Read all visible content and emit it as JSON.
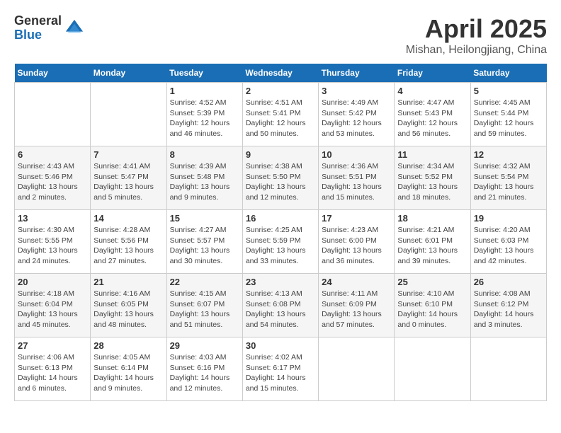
{
  "logo": {
    "general": "General",
    "blue": "Blue"
  },
  "title": "April 2025",
  "subtitle": "Mishan, Heilongjiang, China",
  "days_of_week": [
    "Sunday",
    "Monday",
    "Tuesday",
    "Wednesday",
    "Thursday",
    "Friday",
    "Saturday"
  ],
  "weeks": [
    [
      {
        "day": "",
        "info": ""
      },
      {
        "day": "",
        "info": ""
      },
      {
        "day": "1",
        "info": "Sunrise: 4:52 AM\nSunset: 5:39 PM\nDaylight: 12 hours and 46 minutes."
      },
      {
        "day": "2",
        "info": "Sunrise: 4:51 AM\nSunset: 5:41 PM\nDaylight: 12 hours and 50 minutes."
      },
      {
        "day": "3",
        "info": "Sunrise: 4:49 AM\nSunset: 5:42 PM\nDaylight: 12 hours and 53 minutes."
      },
      {
        "day": "4",
        "info": "Sunrise: 4:47 AM\nSunset: 5:43 PM\nDaylight: 12 hours and 56 minutes."
      },
      {
        "day": "5",
        "info": "Sunrise: 4:45 AM\nSunset: 5:44 PM\nDaylight: 12 hours and 59 minutes."
      }
    ],
    [
      {
        "day": "6",
        "info": "Sunrise: 4:43 AM\nSunset: 5:46 PM\nDaylight: 13 hours and 2 minutes."
      },
      {
        "day": "7",
        "info": "Sunrise: 4:41 AM\nSunset: 5:47 PM\nDaylight: 13 hours and 5 minutes."
      },
      {
        "day": "8",
        "info": "Sunrise: 4:39 AM\nSunset: 5:48 PM\nDaylight: 13 hours and 9 minutes."
      },
      {
        "day": "9",
        "info": "Sunrise: 4:38 AM\nSunset: 5:50 PM\nDaylight: 13 hours and 12 minutes."
      },
      {
        "day": "10",
        "info": "Sunrise: 4:36 AM\nSunset: 5:51 PM\nDaylight: 13 hours and 15 minutes."
      },
      {
        "day": "11",
        "info": "Sunrise: 4:34 AM\nSunset: 5:52 PM\nDaylight: 13 hours and 18 minutes."
      },
      {
        "day": "12",
        "info": "Sunrise: 4:32 AM\nSunset: 5:54 PM\nDaylight: 13 hours and 21 minutes."
      }
    ],
    [
      {
        "day": "13",
        "info": "Sunrise: 4:30 AM\nSunset: 5:55 PM\nDaylight: 13 hours and 24 minutes."
      },
      {
        "day": "14",
        "info": "Sunrise: 4:28 AM\nSunset: 5:56 PM\nDaylight: 13 hours and 27 minutes."
      },
      {
        "day": "15",
        "info": "Sunrise: 4:27 AM\nSunset: 5:57 PM\nDaylight: 13 hours and 30 minutes."
      },
      {
        "day": "16",
        "info": "Sunrise: 4:25 AM\nSunset: 5:59 PM\nDaylight: 13 hours and 33 minutes."
      },
      {
        "day": "17",
        "info": "Sunrise: 4:23 AM\nSunset: 6:00 PM\nDaylight: 13 hours and 36 minutes."
      },
      {
        "day": "18",
        "info": "Sunrise: 4:21 AM\nSunset: 6:01 PM\nDaylight: 13 hours and 39 minutes."
      },
      {
        "day": "19",
        "info": "Sunrise: 4:20 AM\nSunset: 6:03 PM\nDaylight: 13 hours and 42 minutes."
      }
    ],
    [
      {
        "day": "20",
        "info": "Sunrise: 4:18 AM\nSunset: 6:04 PM\nDaylight: 13 hours and 45 minutes."
      },
      {
        "day": "21",
        "info": "Sunrise: 4:16 AM\nSunset: 6:05 PM\nDaylight: 13 hours and 48 minutes."
      },
      {
        "day": "22",
        "info": "Sunrise: 4:15 AM\nSunset: 6:07 PM\nDaylight: 13 hours and 51 minutes."
      },
      {
        "day": "23",
        "info": "Sunrise: 4:13 AM\nSunset: 6:08 PM\nDaylight: 13 hours and 54 minutes."
      },
      {
        "day": "24",
        "info": "Sunrise: 4:11 AM\nSunset: 6:09 PM\nDaylight: 13 hours and 57 minutes."
      },
      {
        "day": "25",
        "info": "Sunrise: 4:10 AM\nSunset: 6:10 PM\nDaylight: 14 hours and 0 minutes."
      },
      {
        "day": "26",
        "info": "Sunrise: 4:08 AM\nSunset: 6:12 PM\nDaylight: 14 hours and 3 minutes."
      }
    ],
    [
      {
        "day": "27",
        "info": "Sunrise: 4:06 AM\nSunset: 6:13 PM\nDaylight: 14 hours and 6 minutes."
      },
      {
        "day": "28",
        "info": "Sunrise: 4:05 AM\nSunset: 6:14 PM\nDaylight: 14 hours and 9 minutes."
      },
      {
        "day": "29",
        "info": "Sunrise: 4:03 AM\nSunset: 6:16 PM\nDaylight: 14 hours and 12 minutes."
      },
      {
        "day": "30",
        "info": "Sunrise: 4:02 AM\nSunset: 6:17 PM\nDaylight: 14 hours and 15 minutes."
      },
      {
        "day": "",
        "info": ""
      },
      {
        "day": "",
        "info": ""
      },
      {
        "day": "",
        "info": ""
      }
    ]
  ]
}
